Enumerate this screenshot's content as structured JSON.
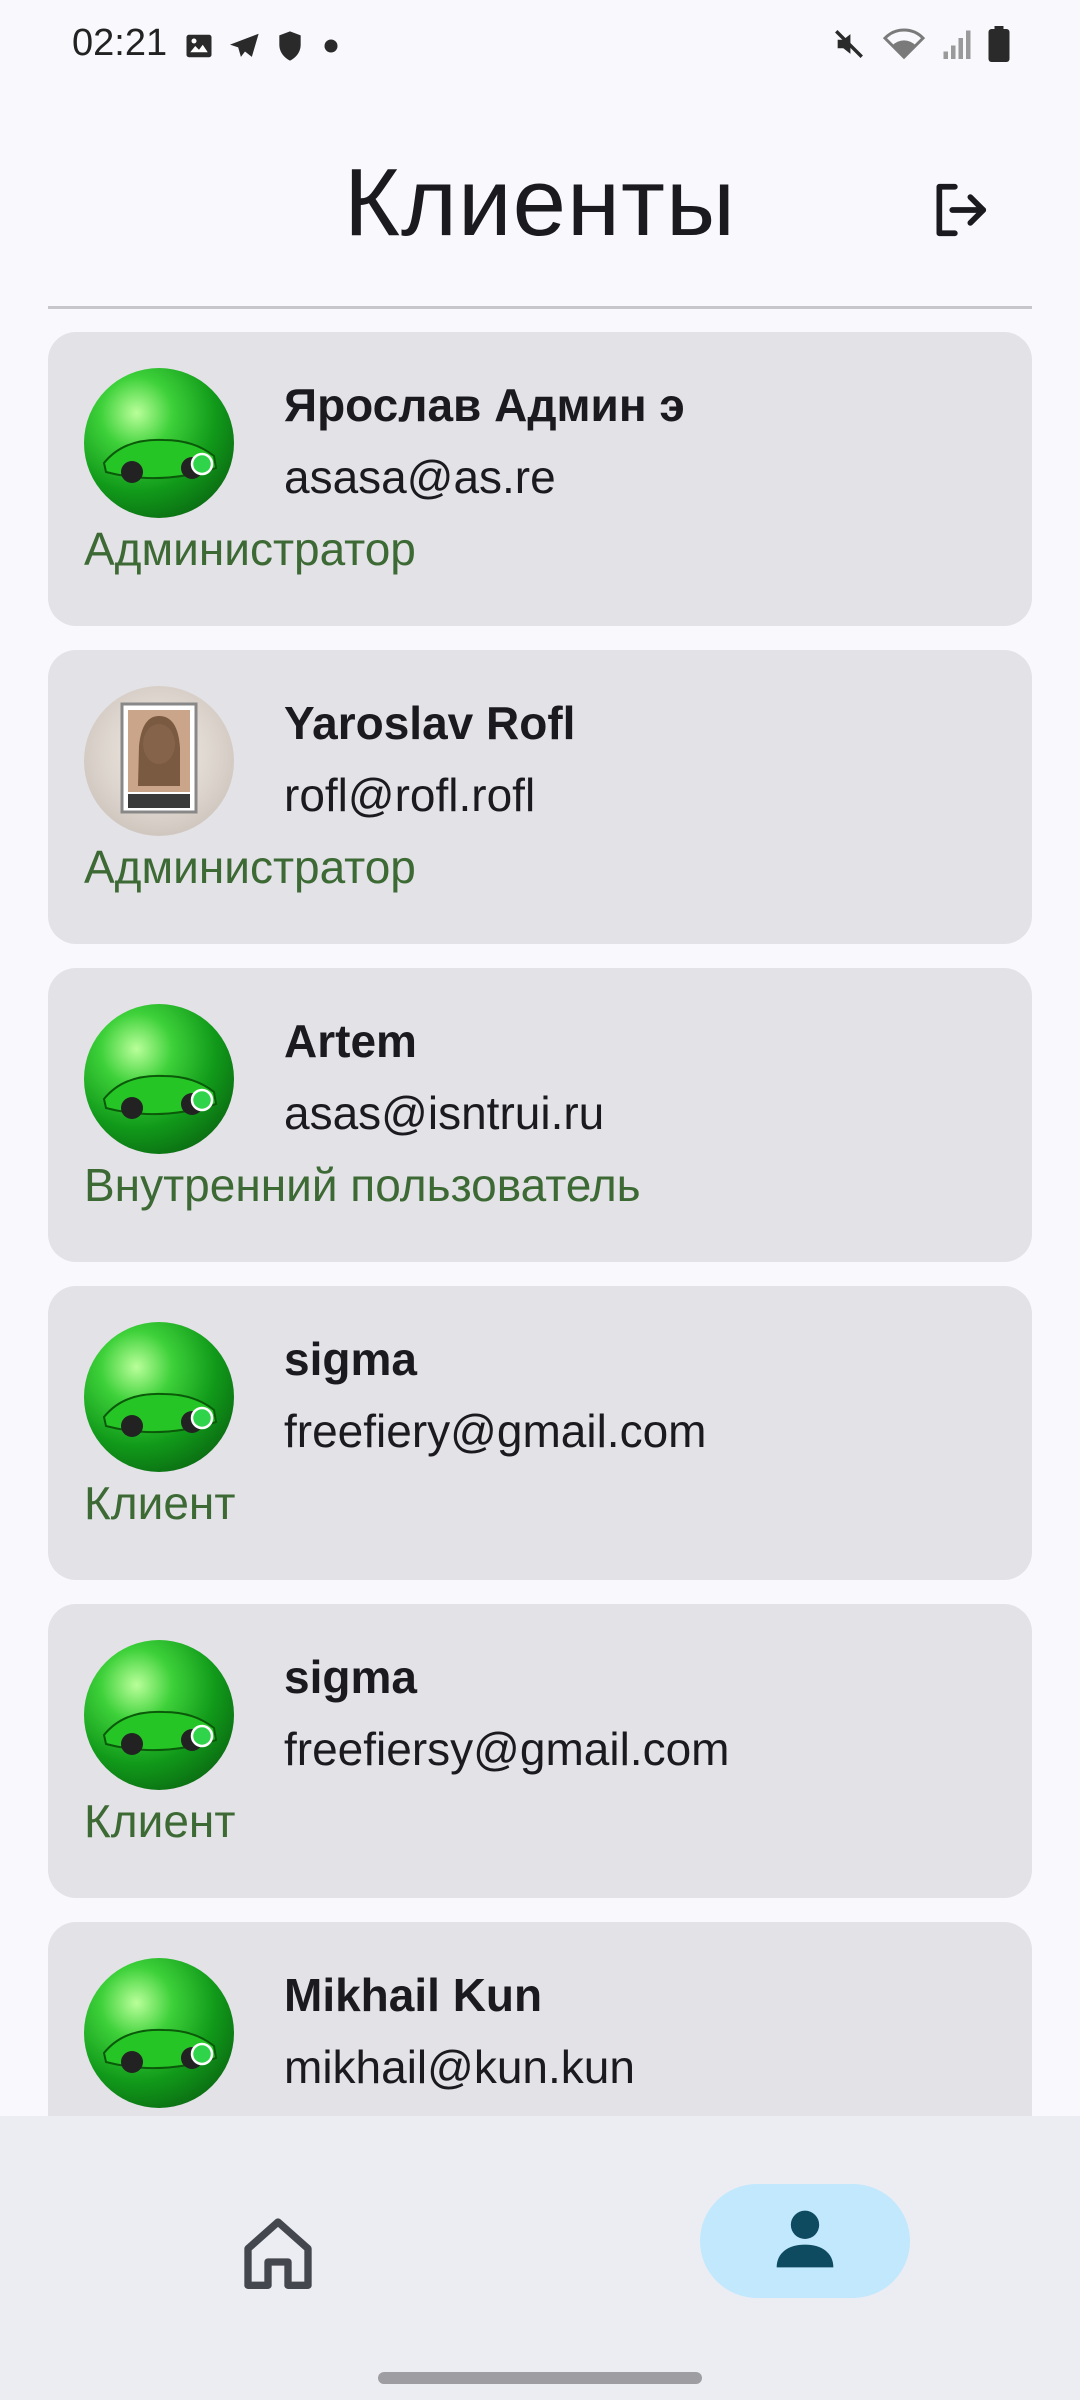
{
  "status_bar": {
    "time": "02:21",
    "left_icons": [
      "image-icon",
      "telegram-icon",
      "shield-icon",
      "dot-icon"
    ],
    "right_icons": [
      "mute-icon",
      "wifi-icon",
      "signal-icon",
      "battery-icon"
    ]
  },
  "header": {
    "title": "Клиенты",
    "logout_icon": "logout-icon"
  },
  "clients": [
    {
      "name": "Ярослав Админ э",
      "email": "asasa@as.re",
      "role": "Администратор",
      "avatar": "green-car-avatar"
    },
    {
      "name": "Yaroslav Rofl",
      "email": "rofl@rofl.rofl",
      "role": "Администратор",
      "avatar": "photo-avatar"
    },
    {
      "name": "Artem",
      "email": "asas@isntrui.ru",
      "role": "Внутренний пользователь",
      "avatar": "green-car-avatar"
    },
    {
      "name": "sigma",
      "email": "freefiery@gmail.com",
      "role": "Клиент",
      "avatar": "green-car-avatar"
    },
    {
      "name": "sigma",
      "email": "freefiersy@gmail.com",
      "role": "Клиент",
      "avatar": "green-car-avatar"
    },
    {
      "name": "Mikhail Kun",
      "email": "mikhail@kun.kun",
      "role": "",
      "avatar": "green-car-avatar"
    }
  ],
  "bottom_nav": {
    "items": [
      {
        "icon": "home-icon",
        "selected": false
      },
      {
        "icon": "person-icon",
        "selected": true
      }
    ]
  },
  "colors": {
    "background": "#f8f8fd",
    "card": "#e2e2e7",
    "role_text": "#3d6a34",
    "nav_active": "#c2e8fd",
    "nav_active_icon": "#0e4a60"
  }
}
